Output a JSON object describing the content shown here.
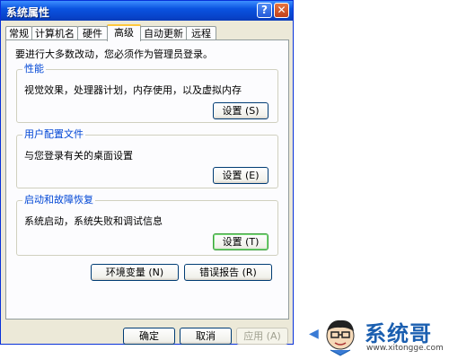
{
  "window": {
    "title": "系统属性",
    "help_label": "?",
    "close_label": "✕"
  },
  "tabs": [
    {
      "label": "常规"
    },
    {
      "label": "计算机名"
    },
    {
      "label": "硬件"
    },
    {
      "label": "高级",
      "active": true
    },
    {
      "label": "自动更新"
    },
    {
      "label": "远程"
    }
  ],
  "panel": {
    "intro": "要进行大多数改动，您必须作为管理员登录。",
    "groups": [
      {
        "title": "性能",
        "description": "视觉效果，处理器计划，内存使用，以及虚拟内存",
        "button": "设置 (S)"
      },
      {
        "title": "用户配置文件",
        "description": "与您登录有关的桌面设置",
        "button": "设置 (E)"
      },
      {
        "title": "启动和故障恢复",
        "description": "系统启动，系统失败和调试信息",
        "button": "设置 (T)"
      }
    ],
    "env_button": "环境变量 (N)",
    "error_report_button": "错误报告 (R)"
  },
  "footer": {
    "ok": "确定",
    "cancel": "取消",
    "apply": "应用 (A)"
  },
  "watermark": {
    "name": "系统哥",
    "url": "www.xitongge.com"
  }
}
